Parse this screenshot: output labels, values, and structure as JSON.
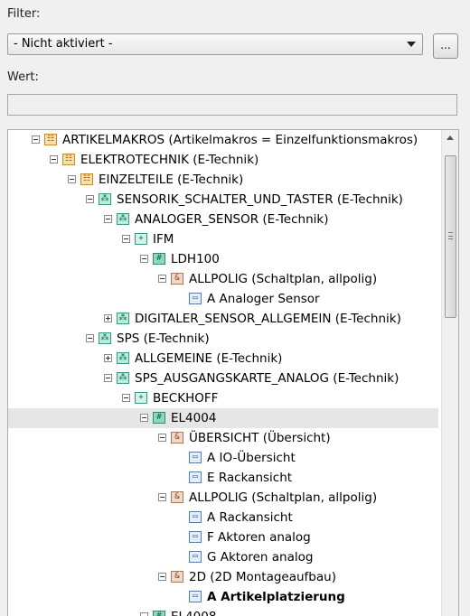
{
  "filter": {
    "label": "Filter:",
    "value": "- Nicht aktiviert -",
    "button": "..."
  },
  "wert": {
    "label": "Wert:",
    "value": ""
  },
  "tree": [
    {
      "level": 0,
      "exp": "minus",
      "icon": "macro",
      "text": "ARTIKELMAKROS (Artikelmakros = Einzelfunktionsmakros)"
    },
    {
      "level": 1,
      "exp": "minus",
      "icon": "macro",
      "text": "ELEKTROTECHNIK (E-Technik)"
    },
    {
      "level": 2,
      "exp": "minus",
      "icon": "macro",
      "text": "EINZELTEILE (E-Technik)"
    },
    {
      "level": 3,
      "exp": "minus",
      "icon": "node",
      "text": "SENSORIK_SCHALTER_UND_TASTER (E-Technik)"
    },
    {
      "level": 4,
      "exp": "minus",
      "icon": "node",
      "text": "ANALOGER_SENSOR (E-Technik)"
    },
    {
      "level": 5,
      "exp": "minus",
      "icon": "plus",
      "text": "IFM"
    },
    {
      "level": 6,
      "exp": "minus",
      "icon": "hash",
      "text": "LDH100"
    },
    {
      "level": 7,
      "exp": "minus",
      "icon": "amp",
      "text": "ALLPOLIG (Schaltplan, allpolig)"
    },
    {
      "level": 8,
      "exp": "none",
      "icon": "page",
      "text": "A Analoger Sensor"
    },
    {
      "level": 4,
      "exp": "plus",
      "icon": "node",
      "text": "DIGITALER_SENSOR_ALLGEMEIN (E-Technik)"
    },
    {
      "level": 3,
      "exp": "minus",
      "icon": "node",
      "text": "SPS (E-Technik)"
    },
    {
      "level": 4,
      "exp": "plus",
      "icon": "node",
      "text": "ALLGEMEINE (E-Technik)"
    },
    {
      "level": 4,
      "exp": "minus",
      "icon": "node",
      "text": "SPS_AUSGANGSKARTE_ANALOG (E-Technik)"
    },
    {
      "level": 5,
      "exp": "minus",
      "icon": "plus",
      "text": "BECKHOFF"
    },
    {
      "level": 6,
      "exp": "minus",
      "icon": "hash",
      "text": "EL4004",
      "selected": true
    },
    {
      "level": 7,
      "exp": "minus",
      "icon": "amp",
      "text": "ÜBERSICHT (Übersicht)"
    },
    {
      "level": 8,
      "exp": "none",
      "icon": "page",
      "text": "A IO-Übersicht"
    },
    {
      "level": 8,
      "exp": "none",
      "icon": "page",
      "text": "E Rackansicht"
    },
    {
      "level": 7,
      "exp": "minus",
      "icon": "amp",
      "text": "ALLPOLIG (Schaltplan, allpolig)"
    },
    {
      "level": 8,
      "exp": "none",
      "icon": "page",
      "text": "A Rackansicht"
    },
    {
      "level": 8,
      "exp": "none",
      "icon": "page",
      "text": "F Aktoren analog"
    },
    {
      "level": 8,
      "exp": "none",
      "icon": "page",
      "text": "G Aktoren analog"
    },
    {
      "level": 7,
      "exp": "minus",
      "icon": "amp",
      "text": "2D (2D Montageaufbau)"
    },
    {
      "level": 8,
      "exp": "none",
      "icon": "page",
      "text": "A Artikelplatzierung",
      "bold": true
    },
    {
      "level": 6,
      "exp": "minus",
      "icon": "hash",
      "text": "EL4008"
    }
  ],
  "icon_glyphs": {
    "macro": "☷",
    "node": "⁂",
    "plus": "+",
    "hash": "#",
    "amp": "&",
    "page": "▭"
  }
}
